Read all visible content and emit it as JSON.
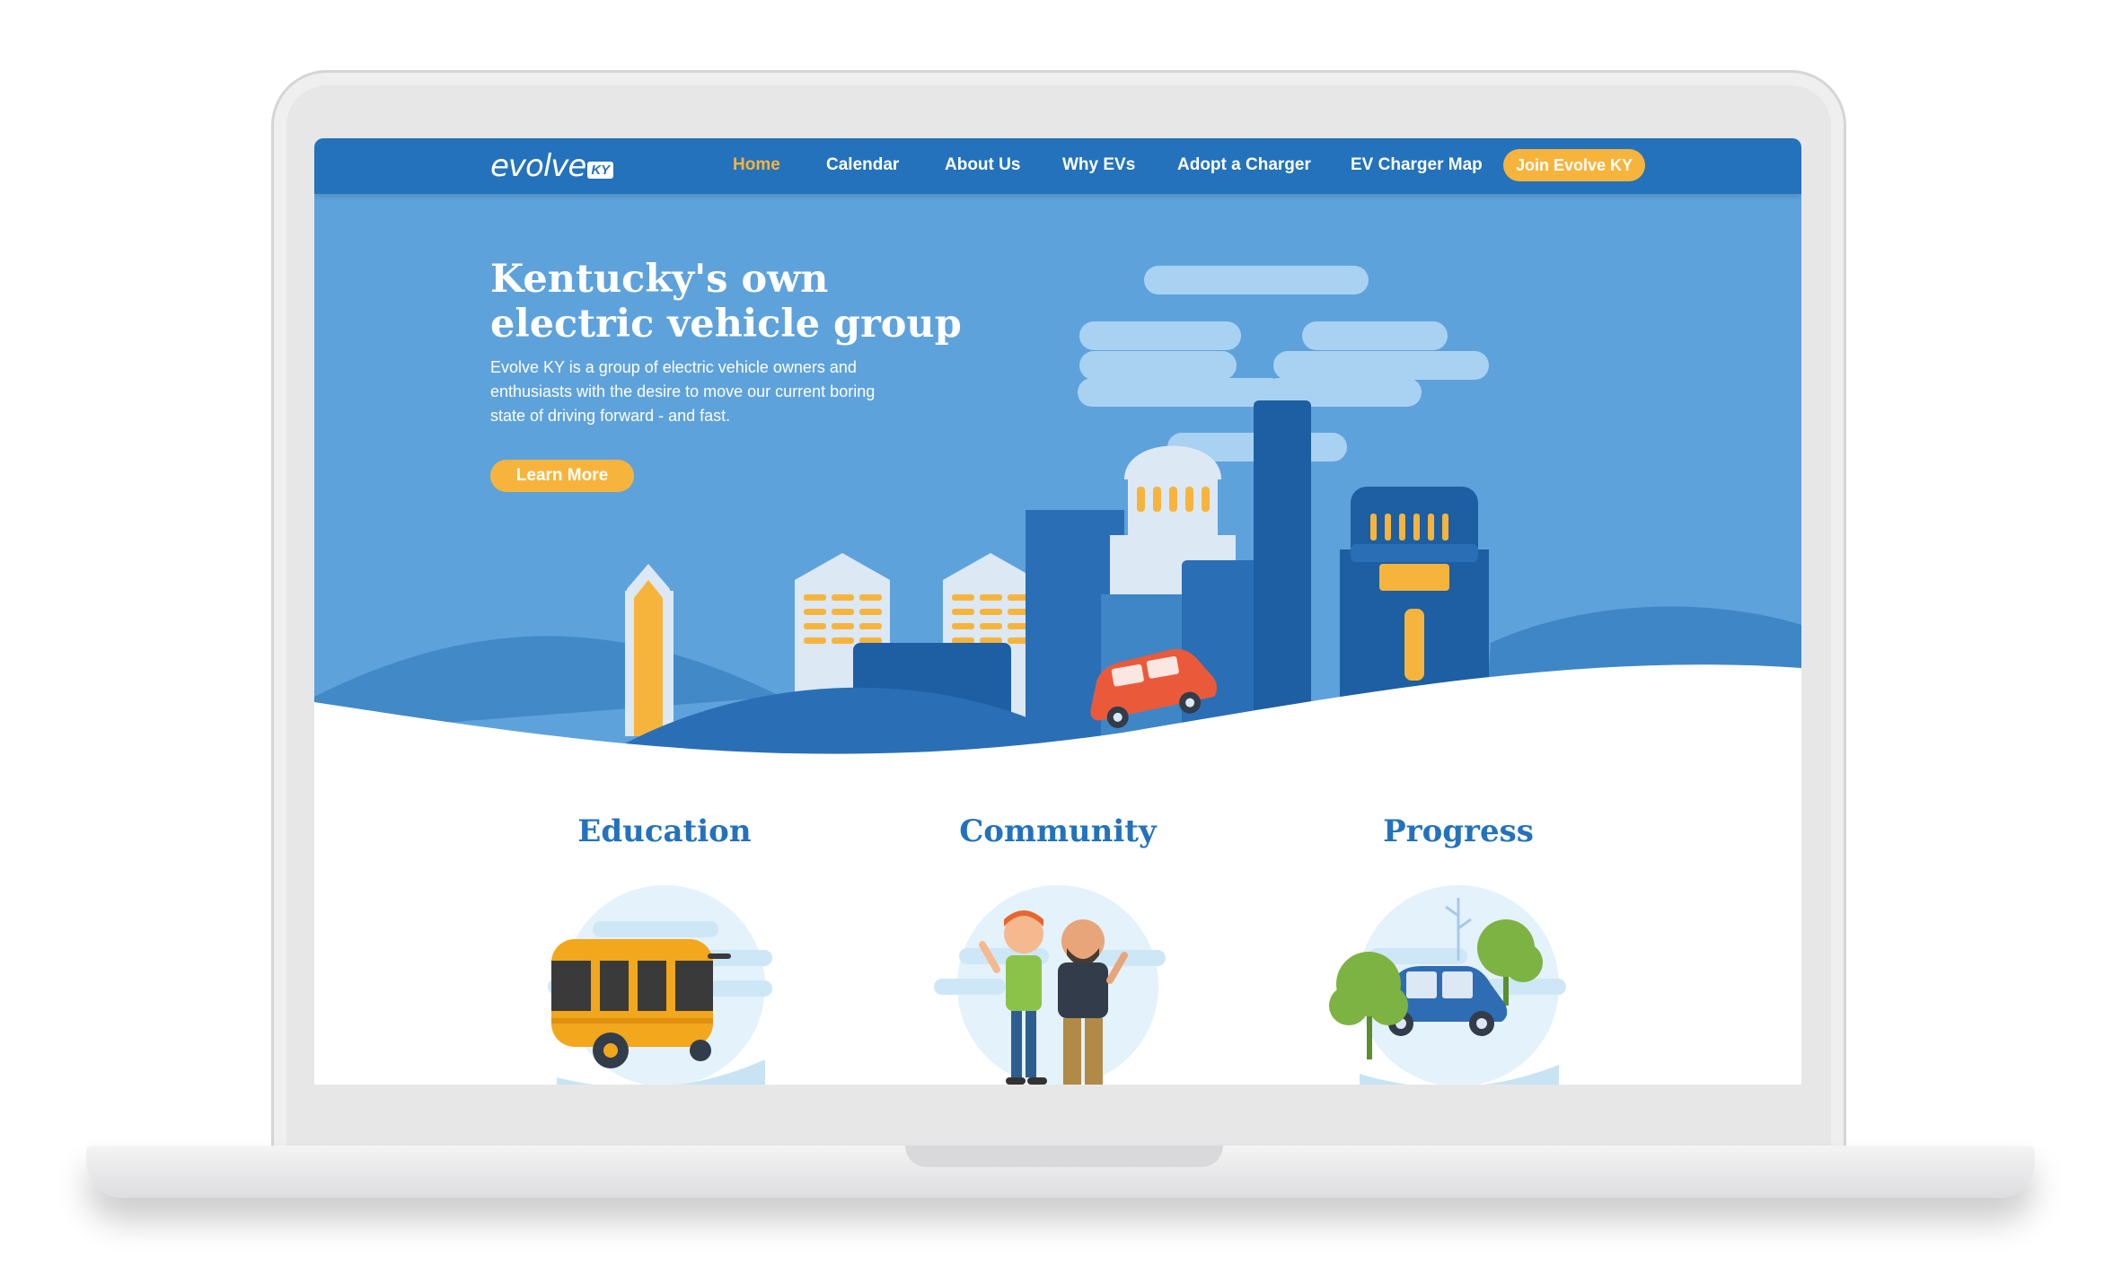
{
  "nav": {
    "logo_word": "evolve",
    "logo_tag": "KY",
    "items": [
      {
        "label": "Home",
        "active": true
      },
      {
        "label": "Calendar",
        "active": false
      },
      {
        "label": "About Us",
        "active": false
      },
      {
        "label": "Why EVs",
        "active": false
      },
      {
        "label": "Adopt a Charger",
        "active": false
      },
      {
        "label": "EV Charger Map",
        "active": false
      }
    ],
    "join_label": "Join Evolve KY"
  },
  "hero": {
    "title": "Kentucky's own electric vehicle group",
    "text": "Evolve KY is a group of electric vehicle owners and enthusiasts with the desire to move our current boring state of driving forward - and fast.",
    "button_label": "Learn More"
  },
  "features": [
    {
      "title": "Education",
      "illustration": "school-bus-illustration"
    },
    {
      "title": "Community",
      "illustration": "two-people-illustration"
    },
    {
      "title": "Progress",
      "illustration": "electric-car-trees-illustration"
    }
  ],
  "colors": {
    "nav_blue": "#2472bb",
    "hero_blue": "#5ea2dc",
    "accent_yellow": "#f7b43c",
    "heading_blue": "#2472bb"
  }
}
